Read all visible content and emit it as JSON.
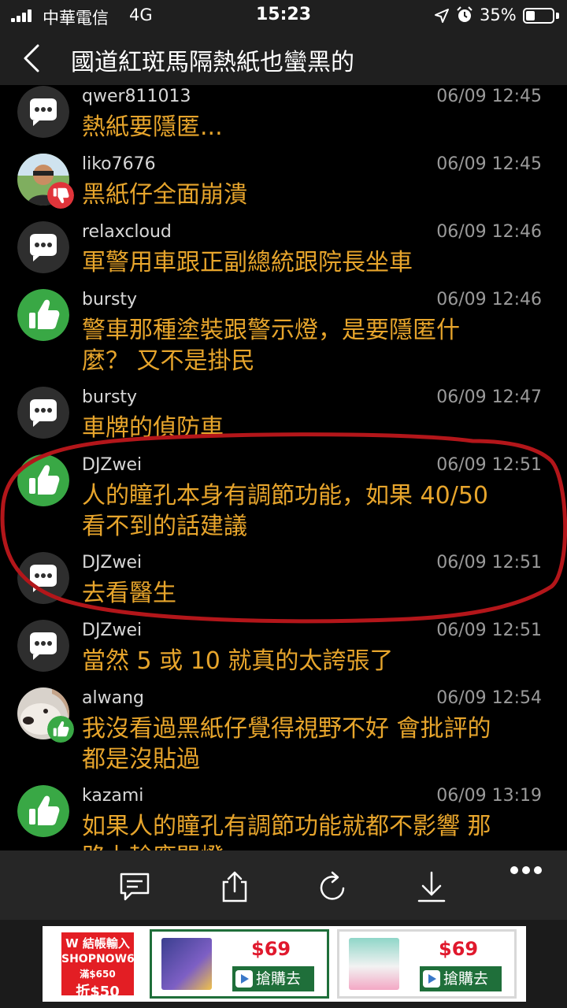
{
  "status_bar": {
    "carrier": "中華電信",
    "network": "4G",
    "time": "15:23",
    "battery": "35%",
    "battery_level": 0.35
  },
  "header": {
    "title": "國道紅斑馬隔熱紙也蠻黑的",
    "back_icon": "chevron-left-icon"
  },
  "comments": [
    {
      "user": "qwer811013",
      "time": "06/09 12:45",
      "lines": [
        "熱紙要隱匿..."
      ],
      "avatar": "speech-bubble-icon"
    },
    {
      "user": "liko7676",
      "time": "06/09 12:45",
      "lines": [
        "黑紙仔全面崩潰"
      ],
      "avatar": "user-photo",
      "badge": "thumbs-down-icon"
    },
    {
      "user": "relaxcloud",
      "time": "06/09 12:46",
      "lines": [
        "軍警用車跟正副總統跟院長坐車"
      ],
      "avatar": "speech-bubble-icon"
    },
    {
      "user": "bursty",
      "time": "06/09 12:46",
      "lines": [
        "警車那種塗裝跟警示燈，是要隱匿什",
        "麼？ 又不是掛民"
      ],
      "avatar": "thumbs-up-icon"
    },
    {
      "user": "bursty",
      "time": "06/09 12:47",
      "lines": [
        "車牌的偵防車"
      ],
      "avatar": "speech-bubble-icon"
    },
    {
      "user": "DJZwei",
      "time": "06/09 12:51",
      "lines": [
        "人的瞳孔本身有調節功能，如果 40/50",
        "看不到的話建議"
      ],
      "avatar": "thumbs-up-icon"
    },
    {
      "user": "DJZwei",
      "time": "06/09 12:51",
      "lines": [
        "去看醫生"
      ],
      "avatar": "speech-bubble-icon"
    },
    {
      "user": "DJZwei",
      "time": "06/09 12:51",
      "lines": [
        "當然 5 或 10 就真的太誇張了"
      ],
      "avatar": "speech-bubble-icon"
    },
    {
      "user": "alwang",
      "time": "06/09 12:54",
      "lines": [
        "我沒看過黑紙仔覺得視野不好 會批評的",
        "都是沒貼過"
      ],
      "avatar": "dog-photo",
      "badge": "thumbs-up-icon"
    },
    {
      "user": "kazami",
      "time": "06/09 13:19",
      "lines": [
        "如果人的瞳孔有調節功能就都不影響 那",
        "路上輪應開燈"
      ],
      "avatar": "thumbs-up-icon"
    }
  ],
  "toolbar": {
    "icons": [
      "comment-icon",
      "share-icon",
      "refresh-icon",
      "download-icon",
      "more-icon"
    ]
  },
  "ad": {
    "logo_line1": "W 結帳輸入",
    "logo_line2": "SHOPNOW6",
    "logo_line3": "滿$650",
    "logo_line4": "折$50",
    "price1": "$69",
    "buy1": "搶購去",
    "price2": "$69",
    "buy2": "搶購去"
  },
  "colors": {
    "comment_text": "#e7a52c",
    "thumbs_up": "#39a845",
    "thumbs_down": "#e0343a",
    "bubble_avatar": "#2e2e2e",
    "highlight": "#b3161a"
  }
}
